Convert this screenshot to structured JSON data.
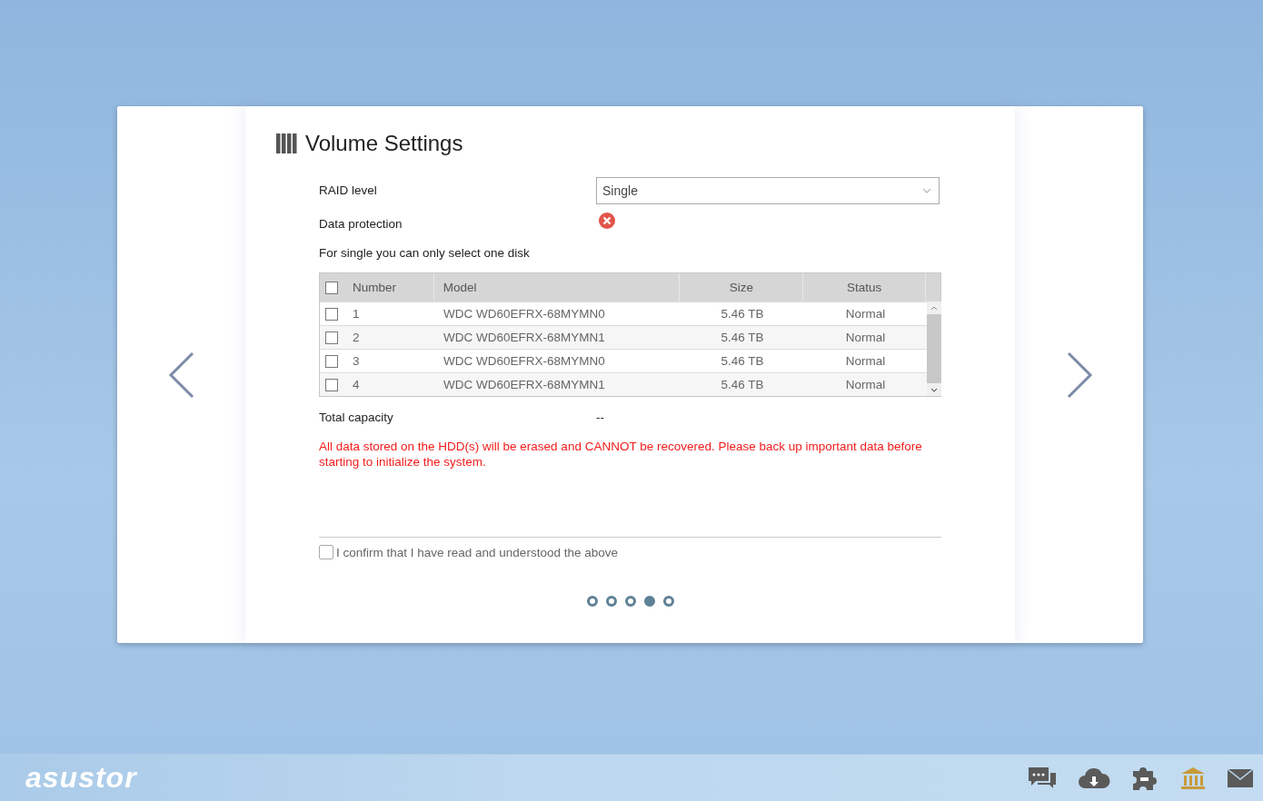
{
  "title": "Volume Settings",
  "fields": [
    {
      "label": "RAID level",
      "kind": "select",
      "value": "Single"
    },
    {
      "label": "Data protection",
      "kind": "status",
      "on": false
    }
  ],
  "note": "For single you can only select one disk",
  "disk_table": {
    "columns": [
      "Number",
      "Model",
      "Size",
      "Status"
    ],
    "all_checked": false,
    "rows": [
      {
        "number": "1",
        "model": "WDC WD60EFRX-68MYMN0",
        "size": "5.46 TB",
        "status": "Normal",
        "checked": false
      },
      {
        "number": "2",
        "model": "WDC WD60EFRX-68MYMN1",
        "size": "5.46 TB",
        "status": "Normal",
        "checked": false
      },
      {
        "number": "3",
        "model": "WDC WD60EFRX-68MYMN0",
        "size": "5.46 TB",
        "status": "Normal",
        "checked": false
      },
      {
        "number": "4",
        "model": "WDC WD60EFRX-68MYMN1",
        "size": "5.46 TB",
        "status": "Normal",
        "checked": false
      }
    ]
  },
  "total_capacity": {
    "label": "Total capacity",
    "value": "--"
  },
  "warning": "All data stored on the HDD(s) will be erased and CANNOT be recovered. Please back up important data before starting to initialize the system.",
  "confirm": {
    "label": "I confirm that I have read and understood the above",
    "checked": false
  },
  "pager": [
    {
      "selected": false
    },
    {
      "selected": false
    },
    {
      "selected": false
    },
    {
      "selected": true
    },
    {
      "selected": false
    }
  ],
  "taskbar": {
    "logo": "asustor",
    "icons": [
      {
        "kind": "chat"
      },
      {
        "kind": "cloud"
      },
      {
        "kind": "puzzle"
      },
      {
        "kind": "bank"
      },
      {
        "kind": "mail"
      }
    ]
  }
}
